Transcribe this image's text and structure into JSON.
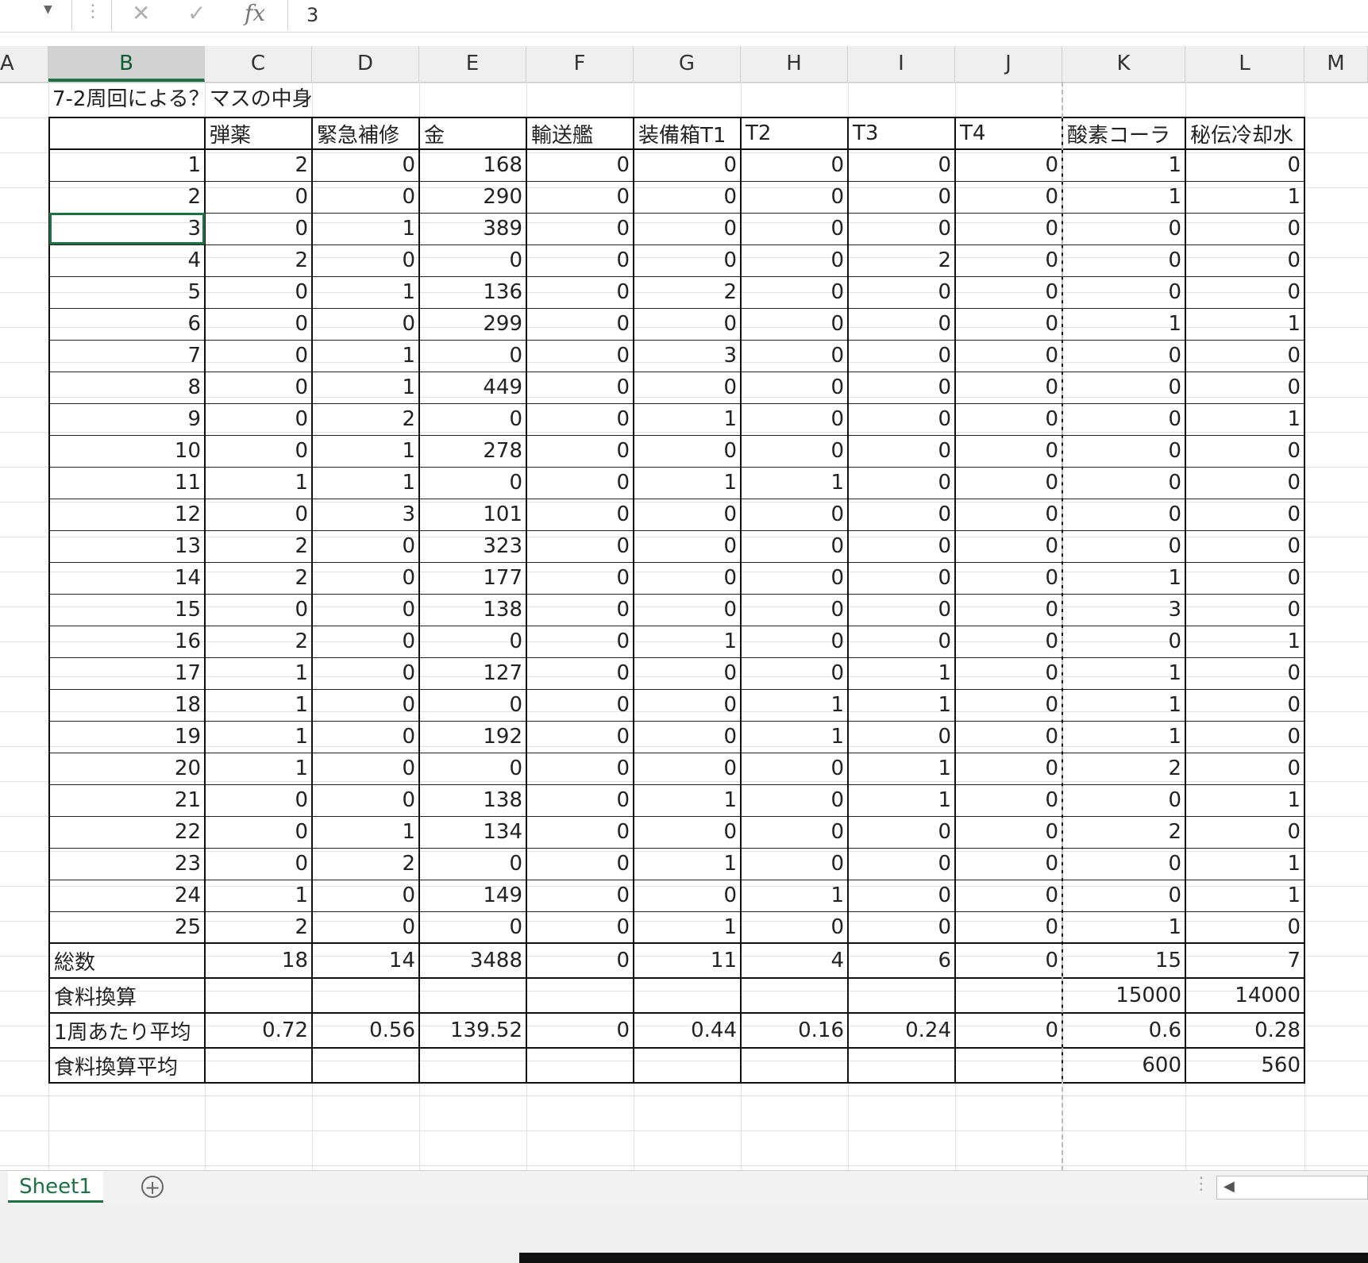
{
  "formula_bar": {
    "value": "3",
    "fx_label": "fx"
  },
  "columns": [
    "A",
    "B",
    "C",
    "D",
    "E",
    "F",
    "G",
    "H",
    "I",
    "J",
    "K",
    "L",
    "M"
  ],
  "selected_column": "B",
  "sheet": {
    "title": "7-2周回による？マスの中身",
    "headers": [
      "",
      "弾薬",
      "緊急補修",
      "金",
      "輸送艦",
      "装備箱T1",
      "T2",
      "T3",
      "T4",
      "酸素コーラ",
      "秘伝冷却水"
    ],
    "rows": [
      [
        "1",
        "2",
        "0",
        "168",
        "0",
        "0",
        "0",
        "0",
        "0",
        "1",
        "0"
      ],
      [
        "2",
        "0",
        "0",
        "290",
        "0",
        "0",
        "0",
        "0",
        "0",
        "1",
        "1"
      ],
      [
        "3",
        "0",
        "1",
        "389",
        "0",
        "0",
        "0",
        "0",
        "0",
        "0",
        "0"
      ],
      [
        "4",
        "2",
        "0",
        "0",
        "0",
        "0",
        "0",
        "2",
        "0",
        "0",
        "0"
      ],
      [
        "5",
        "0",
        "1",
        "136",
        "0",
        "2",
        "0",
        "0",
        "0",
        "0",
        "0"
      ],
      [
        "6",
        "0",
        "0",
        "299",
        "0",
        "0",
        "0",
        "0",
        "0",
        "1",
        "1"
      ],
      [
        "7",
        "0",
        "1",
        "0",
        "0",
        "3",
        "0",
        "0",
        "0",
        "0",
        "0"
      ],
      [
        "8",
        "0",
        "1",
        "449",
        "0",
        "0",
        "0",
        "0",
        "0",
        "0",
        "0"
      ],
      [
        "9",
        "0",
        "2",
        "0",
        "0",
        "1",
        "0",
        "0",
        "0",
        "0",
        "1"
      ],
      [
        "10",
        "0",
        "1",
        "278",
        "0",
        "0",
        "0",
        "0",
        "0",
        "0",
        "0"
      ],
      [
        "11",
        "1",
        "1",
        "0",
        "0",
        "1",
        "1",
        "0",
        "0",
        "0",
        "0"
      ],
      [
        "12",
        "0",
        "3",
        "101",
        "0",
        "0",
        "0",
        "0",
        "0",
        "0",
        "0"
      ],
      [
        "13",
        "2",
        "0",
        "323",
        "0",
        "0",
        "0",
        "0",
        "0",
        "0",
        "0"
      ],
      [
        "14",
        "2",
        "0",
        "177",
        "0",
        "0",
        "0",
        "0",
        "0",
        "1",
        "0"
      ],
      [
        "15",
        "0",
        "0",
        "138",
        "0",
        "0",
        "0",
        "0",
        "0",
        "3",
        "0"
      ],
      [
        "16",
        "2",
        "0",
        "0",
        "0",
        "1",
        "0",
        "0",
        "0",
        "0",
        "1"
      ],
      [
        "17",
        "1",
        "0",
        "127",
        "0",
        "0",
        "0",
        "1",
        "0",
        "1",
        "0"
      ],
      [
        "18",
        "1",
        "0",
        "0",
        "0",
        "0",
        "1",
        "1",
        "0",
        "1",
        "0"
      ],
      [
        "19",
        "1",
        "0",
        "192",
        "0",
        "0",
        "1",
        "0",
        "0",
        "1",
        "0"
      ],
      [
        "20",
        "1",
        "0",
        "0",
        "0",
        "0",
        "0",
        "1",
        "0",
        "2",
        "0"
      ],
      [
        "21",
        "0",
        "0",
        "138",
        "0",
        "1",
        "0",
        "1",
        "0",
        "0",
        "1"
      ],
      [
        "22",
        "0",
        "1",
        "134",
        "0",
        "0",
        "0",
        "0",
        "0",
        "2",
        "0"
      ],
      [
        "23",
        "0",
        "2",
        "0",
        "0",
        "1",
        "0",
        "0",
        "0",
        "0",
        "1"
      ],
      [
        "24",
        "1",
        "0",
        "149",
        "0",
        "0",
        "1",
        "0",
        "0",
        "0",
        "1"
      ],
      [
        "25",
        "2",
        "0",
        "0",
        "0",
        "1",
        "0",
        "0",
        "0",
        "1",
        "0"
      ]
    ],
    "summary": [
      [
        "総数",
        "18",
        "14",
        "3488",
        "0",
        "11",
        "4",
        "6",
        "0",
        "15",
        "7"
      ],
      [
        "食料換算",
        "",
        "",
        "",
        "",
        "",
        "",
        "",
        "",
        "15000",
        "14000"
      ],
      [
        "1周あたり平均",
        "0.72",
        "0.56",
        "139.52",
        "0",
        "0.44",
        "0.16",
        "0.24",
        "0",
        "0.6",
        "0.28"
      ],
      [
        "食料換算平均",
        "",
        "",
        "",
        "",
        "",
        "",
        "",
        "",
        "600",
        "560"
      ]
    ],
    "selected_row_index": 2
  },
  "tabs": {
    "sheet_name": "Sheet1",
    "add_label": "+"
  },
  "colors": {
    "accent": "#1d7145",
    "header_bg": "#efefef"
  }
}
